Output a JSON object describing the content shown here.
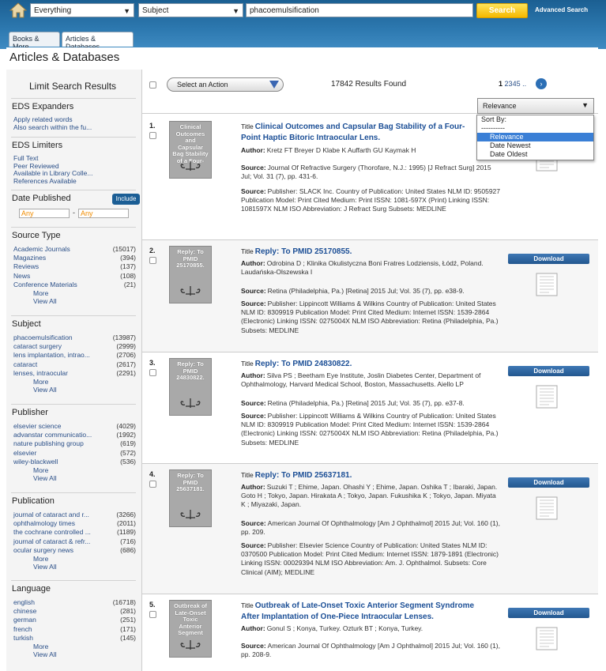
{
  "header": {
    "scope_select": "Everything",
    "field_select": "Subject",
    "query": "phacoemulsification",
    "search_button": "Search",
    "advanced_search": "Advanced Search"
  },
  "tabs": [
    "Books & More",
    "Articles & Databases"
  ],
  "page_title": "Articles & Databases",
  "sidebar": {
    "title": "Limit Search Results",
    "expanders": {
      "heading": "EDS Expanders",
      "items": [
        "Apply related words",
        "Also search within the fu..."
      ]
    },
    "limiters": {
      "heading": "EDS Limiters",
      "items": [
        "Full Text",
        "Peer Reviewed",
        "Available in Library Colle...",
        "References Available"
      ]
    },
    "date": {
      "heading": "Date Published",
      "include": "Include",
      "from": "Any",
      "sep": "-",
      "to": "Any"
    },
    "source_type": {
      "heading": "Source Type",
      "items": [
        {
          "label": "Academic Journals",
          "count": "(15017)"
        },
        {
          "label": "Magazines",
          "count": "(394)"
        },
        {
          "label": "Reviews",
          "count": "(137)"
        },
        {
          "label": "News",
          "count": "(108)"
        },
        {
          "label": "Conference Materials",
          "count": "(21)"
        }
      ]
    },
    "subject": {
      "heading": "Subject",
      "items": [
        {
          "label": "phacoemulsification",
          "count": "(13987)"
        },
        {
          "label": "cataract surgery",
          "count": "(2999)"
        },
        {
          "label": "lens implantation, intrao...",
          "count": "(2706)"
        },
        {
          "label": "cataract",
          "count": "(2617)"
        },
        {
          "label": "lenses, intraocular",
          "count": "(2291)"
        }
      ]
    },
    "publisher": {
      "heading": "Publisher",
      "items": [
        {
          "label": "elsevier science",
          "count": "(4029)"
        },
        {
          "label": "advanstar communicatio...",
          "count": "(1992)"
        },
        {
          "label": "nature publishing group",
          "count": "(619)"
        },
        {
          "label": "elsevier",
          "count": "(572)"
        },
        {
          "label": "wiley-blackwell",
          "count": "(536)"
        }
      ]
    },
    "publication": {
      "heading": "Publication",
      "items": [
        {
          "label": "journal of cataract and r...",
          "count": "(3266)"
        },
        {
          "label": "ophthalmology times",
          "count": "(2011)"
        },
        {
          "label": "the cochrane controlled ...",
          "count": "(1189)"
        },
        {
          "label": "journal of cataract & refr...",
          "count": "(716)"
        },
        {
          "label": "ocular surgery news",
          "count": "(686)"
        }
      ]
    },
    "language": {
      "heading": "Language",
      "items": [
        {
          "label": "english",
          "count": "(16718)"
        },
        {
          "label": "chinese",
          "count": "(281)"
        },
        {
          "label": "german",
          "count": "(251)"
        },
        {
          "label": "french",
          "count": "(171)"
        },
        {
          "label": "turkish",
          "count": "(145)"
        }
      ]
    },
    "more": "More",
    "view_all": "View All"
  },
  "toolbar": {
    "action_select": "Select an Action",
    "results_found": "17842 Results Found",
    "pages": [
      "1",
      "2",
      "3",
      "4",
      "5",
      ".."
    ],
    "sort_selected": "Relevance",
    "sort_menu": [
      "Sort By:",
      "----------",
      "Relevance",
      "Date Newest",
      "Date Oldest"
    ]
  },
  "labels": {
    "title": "Title",
    "author": "Author:",
    "source": "Source:",
    "download": "Download"
  },
  "results": [
    {
      "num": "1.",
      "thumb": "Clinical Outcomes and Capsular Bag Stability of a Four-",
      "title": "Clinical Outcomes and Capsular Bag Stability of a Four-Point Haptic Bitoric Intraocular Lens.",
      "author": "Kretz FT Breyer D Klabe K Auffarth GU Kaymak H",
      "source1": "Journal Of Refractive Surgery (Thorofare, N.J.: 1995) [J Refract Surg] 2015 Jul; Vol. 31 (7), pp. 431-6.",
      "source2": "Publisher: SLACK Inc. Country of Publication: United States NLM ID: 9505927 Publication Model: Print Cited Medium: Print ISSN: 1081-597X (Print) Linking ISSN: 1081597X NLM ISO Abbreviation: J Refract Surg Subsets: MEDLINE"
    },
    {
      "num": "2.",
      "thumb": "Reply: To PMID 25170855.",
      "title": "Reply: To PMID 25170855.",
      "author": "Odrobina D ; Klinika Okulistyczna Boni Fratres Lodziensis, Łódź, Poland. Laudańska-Olszewska I",
      "source1": "Retina (Philadelphia, Pa.) [Retina] 2015 Jul; Vol. 35 (7), pp. e38-9.",
      "source2": "Publisher: Lippincott Williams & Wilkins Country of Publication: United States NLM ID: 8309919 Publication Model: Print Cited Medium: Internet ISSN: 1539-2864 (Electronic) Linking ISSN: 0275004X NLM ISO Abbreviation: Retina (Philadelphia, Pa.) Subsets: MEDLINE"
    },
    {
      "num": "3.",
      "thumb": "Reply: To PMID 24830822.",
      "title": "Reply: To PMID 24830822.",
      "author": "Silva PS ; Beetham Eye Institute, Joslin Diabetes Center, Department of Ophthalmology, Harvard Medical School, Boston, Massachusetts. Aiello LP",
      "source1": "Retina (Philadelphia, Pa.) [Retina] 2015 Jul; Vol. 35 (7), pp. e37-8.",
      "source2": "Publisher: Lippincott Williams & Wilkins Country of Publication: United States NLM ID: 8309919 Publication Model: Print Cited Medium: Internet ISSN: 1539-2864 (Electronic) Linking ISSN: 0275004X NLM ISO Abbreviation: Retina (Philadelphia, Pa.) Subsets: MEDLINE"
    },
    {
      "num": "4.",
      "thumb": "Reply: To PMID 25637181.",
      "title": "Reply: To PMID 25637181.",
      "author": "Suzuki T ; Ehime, Japan. Ohashi Y ; Ehime, Japan. Oshika T ; Ibaraki, Japan. Goto H ; Tokyo, Japan. Hirakata A ; Tokyo, Japan. Fukushika K ; Tokyo, Japan. Miyata K ; Miyazaki, Japan.",
      "source1": "American Journal Of Ophthalmology [Am J Ophthalmol] 2015 Jul; Vol. 160 (1), pp. 209.",
      "source2": "Publisher: Elsevier Science Country of Publication: United States NLM ID: 0370500 Publication Model: Print Cited Medium: Internet ISSN: 1879-1891 (Electronic) Linking ISSN: 00029394 NLM ISO Abbreviation: Am. J. Ophthalmol. Subsets: Core Clinical (AIM); MEDLINE"
    },
    {
      "num": "5.",
      "thumb": "Outbreak of Late-Onset Toxic Anterior Segment",
      "title": "Outbreak of Late-Onset Toxic Anterior Segment Syndrome After Implantation of One-Piece Intraocular Lenses.",
      "author": "Gonul S ; Konya, Turkey. Ozturk BT ; Konya, Turkey.",
      "source1": "American Journal Of Ophthalmology [Am J Ophthalmol] 2015 Jul; Vol. 160 (1), pp. 208-9.",
      "source2": ""
    }
  ]
}
